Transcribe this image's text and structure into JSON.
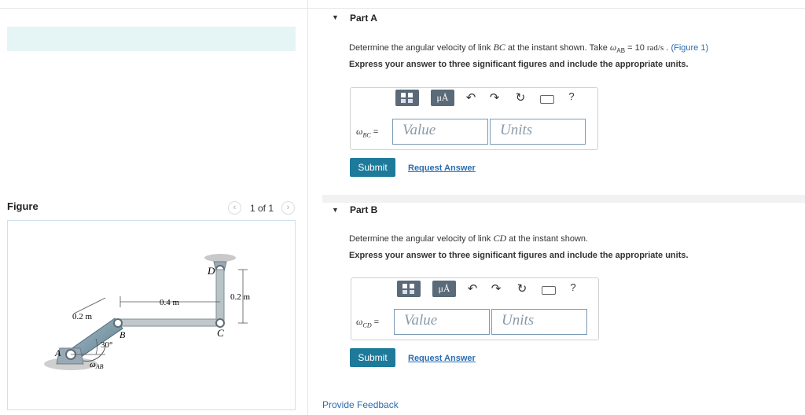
{
  "left_panel": {
    "figure_title": "Figure",
    "pager": {
      "prev_icon": "chevron-left-icon",
      "next_icon": "chevron-right-icon",
      "text": "1 of 1"
    },
    "figure": {
      "labels": {
        "D": "D",
        "C": "C",
        "B": "B",
        "A": "A",
        "dim_04": "0.4 m",
        "dim_02_right": "0.2 m",
        "dim_02_left": "0.2 m",
        "angle": "30°",
        "omega": "ω",
        "omega_sub": "AB"
      }
    }
  },
  "part_a": {
    "title": "Part A",
    "question_pre": "Determine the angular velocity of link ",
    "question_link": "BC",
    "question_mid": " at the instant shown. Take ",
    "omega_sym": "ω",
    "omega_sub": "AB",
    "question_eq": " = 10 ",
    "question_unit": "rad/s",
    "question_post": " . ",
    "figure_link": "(Figure 1)",
    "instruction": "Express your answer to three significant figures and include the appropriate units.",
    "var_sym": "ω",
    "var_sub": "BC",
    "var_eq": " =",
    "value_placeholder": "Value",
    "units_placeholder": "Units",
    "submit_label": "Submit",
    "request_label": "Request Answer"
  },
  "part_b": {
    "title": "Part B",
    "question_pre": "Determine the angular velocity of link ",
    "question_link": "CD",
    "question_post": " at the instant shown.",
    "instruction": "Express your answer to three significant figures and include the appropriate units.",
    "var_sym": "ω",
    "var_sub": "CD",
    "var_eq": " =",
    "value_placeholder": "Value",
    "units_placeholder": "Units",
    "submit_label": "Submit",
    "request_label": "Request Answer"
  },
  "toolbar": {
    "mu_label": "μÅ",
    "help_label": "?",
    "icons": [
      "templates-icon",
      "units-icon",
      "undo-icon",
      "redo-icon",
      "reset-icon",
      "keyboard-icon",
      "help-icon"
    ]
  },
  "footer": {
    "feedback_label": "Provide Feedback"
  }
}
